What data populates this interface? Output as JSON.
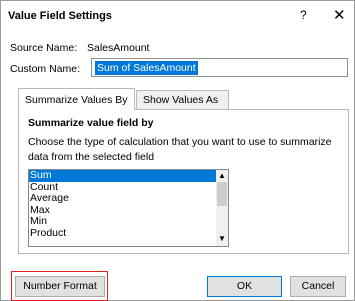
{
  "dialog": {
    "title": "Value Field Settings",
    "help_glyph": "?",
    "close_glyph": "✕"
  },
  "source": {
    "label": "Source Name:",
    "value": "SalesAmount"
  },
  "custom": {
    "label": "Custom Name:",
    "value": "Sum of SalesAmount"
  },
  "tabs": [
    {
      "label": "Summarize Values By",
      "active": true
    },
    {
      "label": "Show Values As",
      "active": false
    }
  ],
  "summarize": {
    "heading": "Summarize value field by",
    "description": "Choose the type of calculation that you want to use to summarize data from the selected field",
    "options": [
      "Sum",
      "Count",
      "Average",
      "Max",
      "Min",
      "Product"
    ],
    "selected": "Sum"
  },
  "buttons": {
    "number_format": "Number Format",
    "ok": "OK",
    "cancel": "Cancel"
  },
  "colors": {
    "selection": "#0078d7",
    "highlight_box": "#e02020"
  }
}
